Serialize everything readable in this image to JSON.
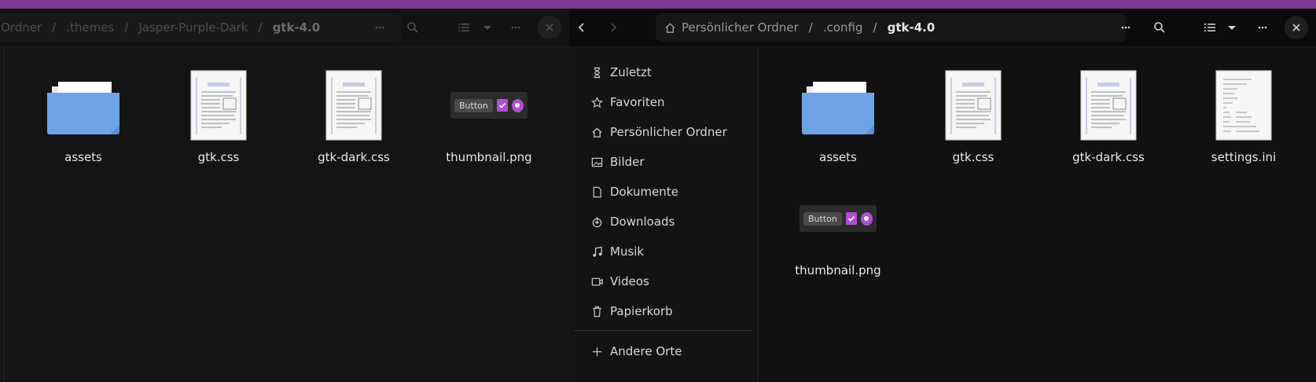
{
  "left_window": {
    "breadcrumbs": [
      "Ordner",
      ".themes",
      "Jasper-Purple-Dark",
      "gtk-4.0"
    ],
    "files": [
      {
        "name": "assets",
        "kind": "folder"
      },
      {
        "name": "gtk.css",
        "kind": "css"
      },
      {
        "name": "gtk-dark.css",
        "kind": "css"
      },
      {
        "name": "thumbnail.png",
        "kind": "thumbnail"
      }
    ]
  },
  "right_window": {
    "breadcrumbs": [
      "Persönlicher Ordner",
      ".config",
      "gtk-4.0"
    ],
    "sidebar": {
      "items": [
        {
          "label": "Zuletzt",
          "icon": "clock-icon"
        },
        {
          "label": "Favoriten",
          "icon": "star-icon"
        },
        {
          "label": "Persönlicher Ordner",
          "icon": "home-icon"
        },
        {
          "label": "Bilder",
          "icon": "image-icon"
        },
        {
          "label": "Dokumente",
          "icon": "document-icon"
        },
        {
          "label": "Downloads",
          "icon": "download-icon"
        },
        {
          "label": "Musik",
          "icon": "music-icon"
        },
        {
          "label": "Videos",
          "icon": "video-icon"
        },
        {
          "label": "Papierkorb",
          "icon": "trash-icon"
        }
      ],
      "other_places": {
        "label": "Andere Orte",
        "icon": "plus-icon"
      }
    },
    "files": [
      {
        "name": "assets",
        "kind": "folder"
      },
      {
        "name": "gtk.css",
        "kind": "css"
      },
      {
        "name": "gtk-dark.css",
        "kind": "css"
      },
      {
        "name": "settings.ini",
        "kind": "ini"
      },
      {
        "name": "thumbnail.png",
        "kind": "thumbnail"
      }
    ]
  },
  "thumbnail_preview": {
    "button_label": "Button"
  },
  "colors": {
    "accent": "#b04fd1",
    "folder": "#6ea3e8",
    "topbar": "#7a3a91"
  }
}
